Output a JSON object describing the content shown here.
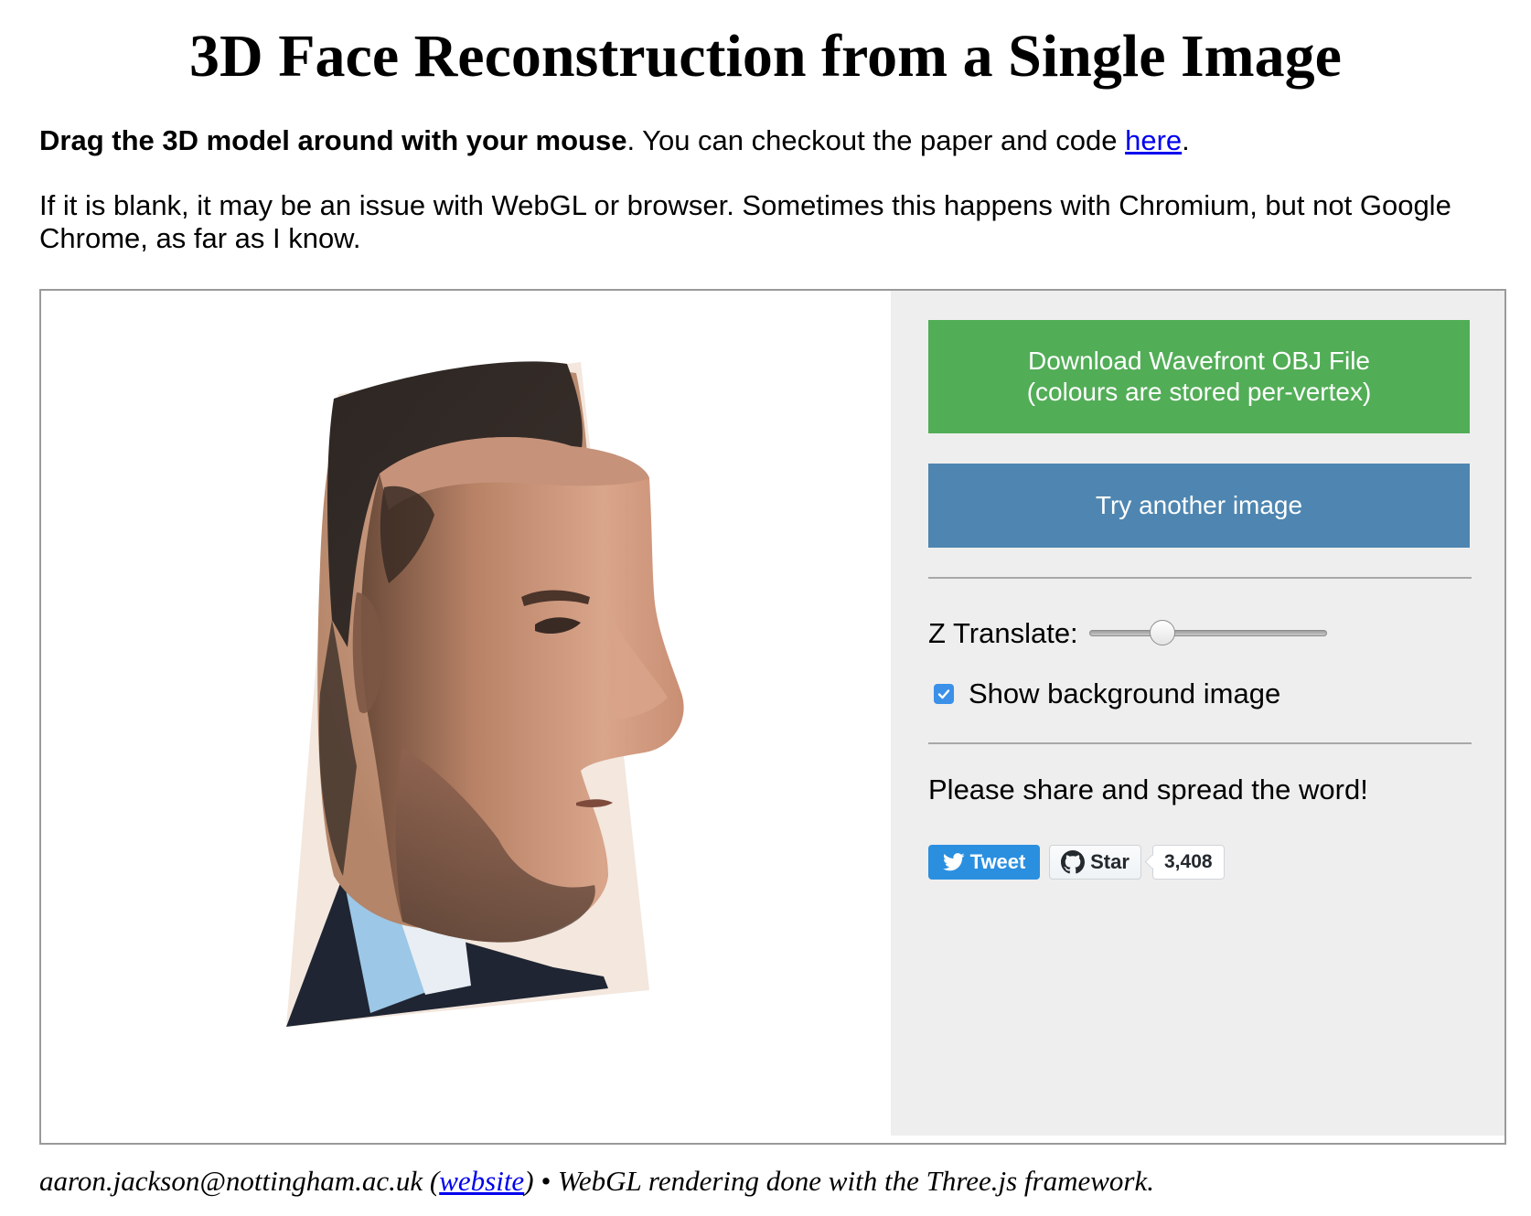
{
  "page": {
    "title": "3D Face Reconstruction from a Single Image"
  },
  "intro": {
    "bold": "Drag the 3D model around with your mouse",
    "text": ". You can checkout the paper and code ",
    "link": "here",
    "end": "."
  },
  "note": {
    "text": "If it is blank, it may be an issue with WebGL or browser. Sometimes this happens with Chromium, but not Google Chrome, as far as I know."
  },
  "controls": {
    "download_line1": "Download Wavefront OBJ File",
    "download_line2": "(colours are stored per-vertex)",
    "try_another": "Try another image",
    "z_translate_label": "Z Translate:",
    "z_translate_value_fraction": 0.31,
    "show_background_label": "Show background image",
    "show_background_checked": true,
    "share_text": "Please share and spread the word!",
    "tweet_label": "Tweet",
    "star_label": "Star",
    "star_count": "3,408"
  },
  "footer": {
    "email": "aaron.jackson@nottingham.ac.uk (",
    "link": "website",
    "rest": ") • WebGL rendering done with the Three.js framework."
  },
  "colors": {
    "download_green": "#52ad57",
    "try_blue": "#4e86b1",
    "panel_bg": "#eeeeee",
    "tweet_blue": "#2b8fe0",
    "link_blue": "#0000ee"
  }
}
